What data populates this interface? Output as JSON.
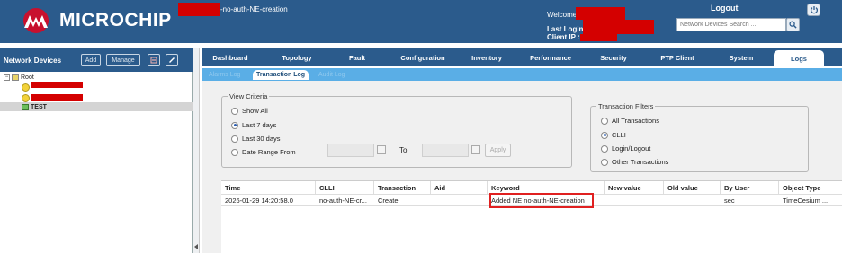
{
  "header": {
    "brand": "MICROCHIP",
    "context_suffix": "-no-auth-NE-creation",
    "welcome_label": "Welcome",
    "last_login_label": "Last Login :",
    "client_ip_label": "Client IP :",
    "logout_label": "Logout",
    "search_placeholder": "Network Devices Search ...",
    "search_icon": "magnifier-icon",
    "power_icon": "power-icon"
  },
  "left_panel": {
    "title": "Network Devices",
    "buttons": {
      "add": "Add",
      "manage": "Manage"
    },
    "tree": {
      "root_label": "Root",
      "selected_label": "TEST"
    }
  },
  "nav": {
    "tabs": [
      "Dashboard",
      "Topology",
      "Fault",
      "Configuration",
      "Inventory",
      "Performance",
      "Security",
      "PTP Client",
      "System",
      "Logs"
    ],
    "active": "Logs"
  },
  "subtabs": {
    "left_dim": "Alarms Log",
    "active": "Transaction Log",
    "right_dim": "Audit Log"
  },
  "view_criteria": {
    "legend": "View Criteria",
    "options": [
      "Show All",
      "Last 7 days",
      "Last 30 days",
      "Date Range From"
    ],
    "selected": "Last 7 days",
    "to_label": "To",
    "apply_label": "Apply"
  },
  "transaction_filters": {
    "legend": "Transaction Filters",
    "options": [
      "All Transactions",
      "CLLI",
      "Login/Logout",
      "Other Transactions"
    ],
    "selected": "CLLI"
  },
  "table": {
    "columns": [
      "Time",
      "CLLI",
      "Transaction",
      "Aid",
      "Keyword",
      "New value",
      "Old value",
      "By User",
      "Object Type"
    ],
    "rows": [
      {
        "time": "2026-01-29 14:20:58.0",
        "clli": "no-auth-NE-cr...",
        "transaction": "Create",
        "aid": "",
        "keyword": "Added NE no-auth-NE-creation",
        "new_value": "",
        "old_value": "",
        "by_user": "sec",
        "object_type": "TimeCesium ..."
      }
    ]
  },
  "colors": {
    "header_blue": "#2b5b8c",
    "subtab_blue": "#5aaee6",
    "redaction_red": "#d40000",
    "highlight_red": "#e02020"
  }
}
